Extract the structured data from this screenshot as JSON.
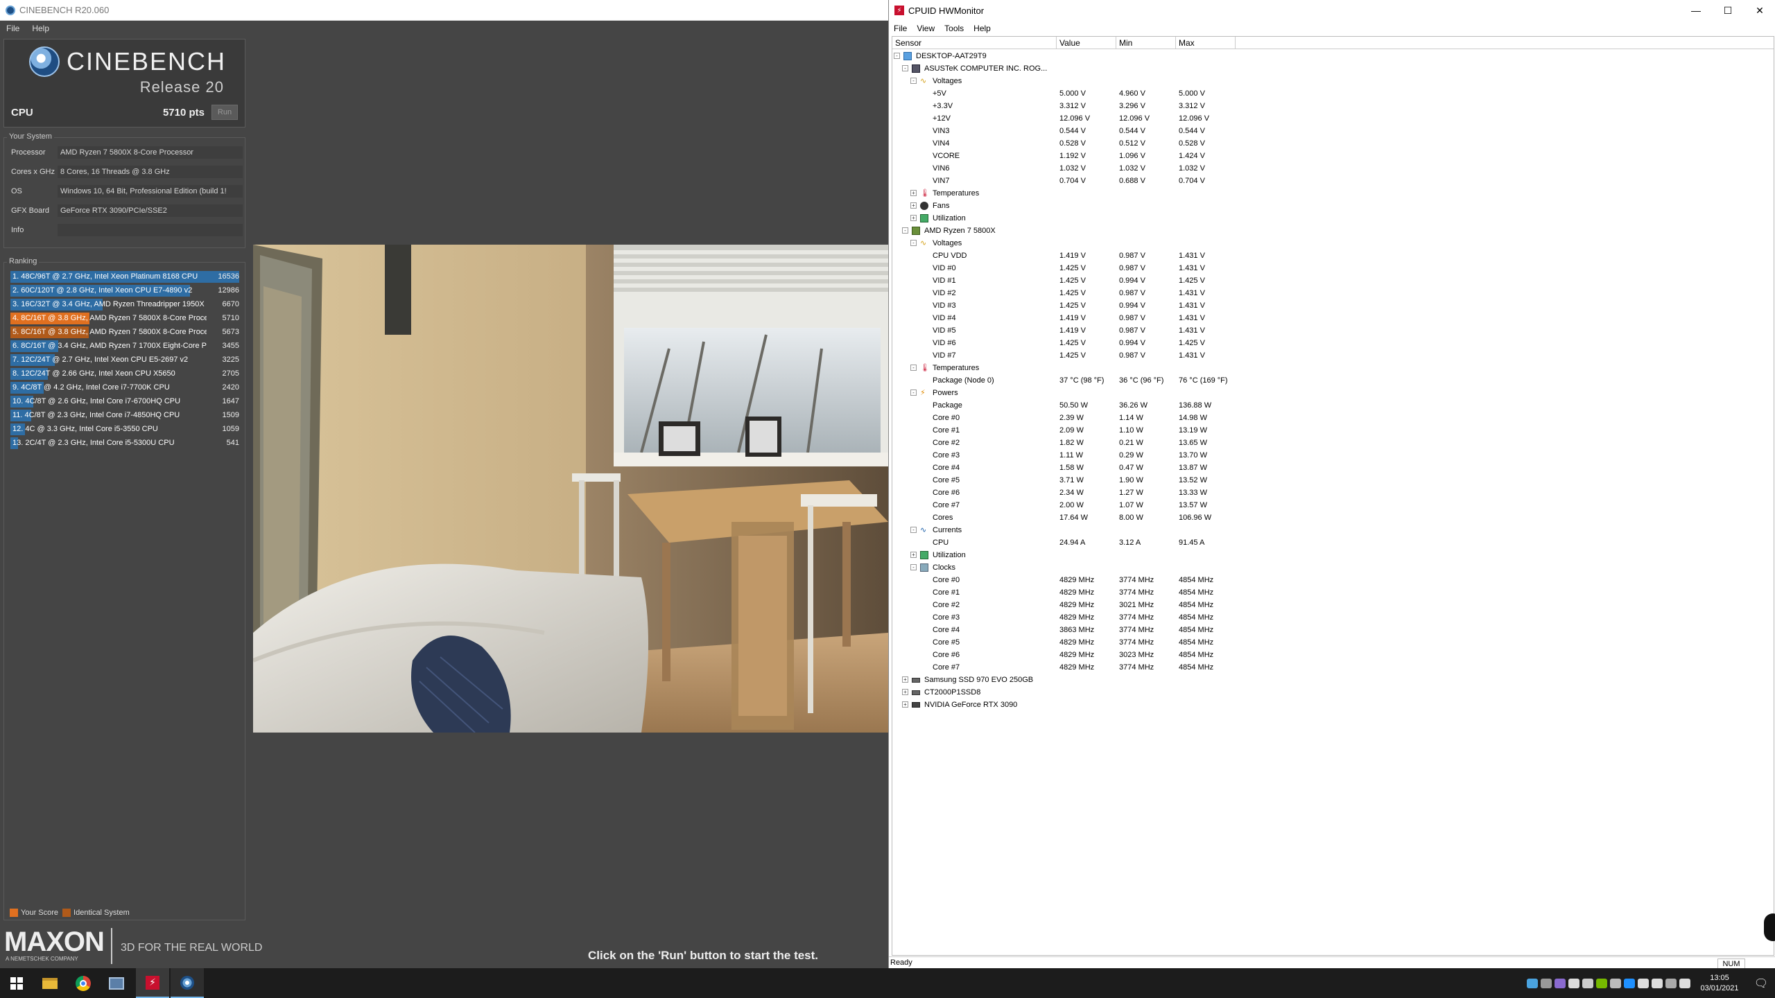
{
  "cinebench": {
    "window_title": "CINEBENCH R20.060",
    "menu": [
      "File",
      "Help"
    ],
    "logo_text": "CINEBENCH",
    "release": "Release 20",
    "cpu_label": "CPU",
    "cpu_score": "5710 pts",
    "run_label": "Run",
    "your_system": {
      "title": "Your System",
      "rows": [
        {
          "label": "Processor",
          "value": "AMD Ryzen 7 5800X 8-Core Processor"
        },
        {
          "label": "Cores x GHz",
          "value": "8 Cores, 16 Threads @ 3.8 GHz"
        },
        {
          "label": "OS",
          "value": "Windows 10, 64 Bit, Professional Edition (build 1!"
        },
        {
          "label": "GFX Board",
          "value": "GeForce RTX 3090/PCIe/SSE2"
        },
        {
          "label": "Info",
          "value": ""
        }
      ]
    },
    "ranking": {
      "title": "Ranking",
      "max_score": 16536,
      "rows": [
        {
          "label": "1. 48C/96T @ 2.7 GHz, Intel Xeon Platinum 8168 CPU",
          "score": "16536",
          "value": 16536,
          "kind": "blue"
        },
        {
          "label": "2. 60C/120T @ 2.8 GHz, Intel Xeon CPU E7-4890 v2",
          "score": "12986",
          "value": 12986,
          "kind": "blue"
        },
        {
          "label": "3. 16C/32T @ 3.4 GHz, AMD Ryzen Threadripper 1950X",
          "score": "6670",
          "value": 6670,
          "kind": "blue"
        },
        {
          "label": "4. 8C/16T @ 3.8 GHz, AMD Ryzen 7 5800X 8-Core Proce:",
          "score": "5710",
          "value": 5710,
          "kind": "your"
        },
        {
          "label": "5. 8C/16T @ 3.8 GHz, AMD Ryzen 7 5800X 8-Core Proce:",
          "score": "5673",
          "value": 5673,
          "kind": "identical"
        },
        {
          "label": "6. 8C/16T @ 3.4 GHz, AMD Ryzen 7 1700X Eight-Core Pi",
          "score": "3455",
          "value": 3455,
          "kind": "blue"
        },
        {
          "label": "7. 12C/24T @ 2.7 GHz, Intel Xeon CPU E5-2697 v2",
          "score": "3225",
          "value": 3225,
          "kind": "blue"
        },
        {
          "label": "8. 12C/24T @ 2.66 GHz, Intel Xeon CPU X5650",
          "score": "2705",
          "value": 2705,
          "kind": "blue"
        },
        {
          "label": "9. 4C/8T @ 4.2 GHz, Intel Core i7-7700K CPU",
          "score": "2420",
          "value": 2420,
          "kind": "blue"
        },
        {
          "label": "10. 4C/8T @ 2.6 GHz, Intel Core i7-6700HQ CPU",
          "score": "1647",
          "value": 1647,
          "kind": "blue"
        },
        {
          "label": "11. 4C/8T @ 2.3 GHz, Intel Core i7-4850HQ CPU",
          "score": "1509",
          "value": 1509,
          "kind": "blue"
        },
        {
          "label": "12. 4C @ 3.3 GHz, Intel Core i5-3550 CPU",
          "score": "1059",
          "value": 1059,
          "kind": "blue"
        },
        {
          "label": "13. 2C/4T @ 2.3 GHz, Intel Core i5-5300U CPU",
          "score": "541",
          "value": 541,
          "kind": "blue"
        }
      ]
    },
    "legend": {
      "your_score": "Your Score",
      "identical_system": "Identical System"
    },
    "footer": {
      "brand": "MAXON",
      "brand_sub": "A NEMETSCHEK COMPANY",
      "tagline": "3D FOR THE REAL WORLD",
      "message": "Click on the 'Run' button to start the test."
    },
    "colors": {
      "blue_bar": "#2e6da4",
      "your_score": "#e07020",
      "identical": "#b05a1a"
    }
  },
  "hwmonitor": {
    "window_title": "CPUID HWMonitor",
    "menu": [
      "File",
      "View",
      "Tools",
      "Help"
    ],
    "columns": [
      "Sensor",
      "Value",
      "Min",
      "Max"
    ],
    "rows": [
      {
        "level": 0,
        "exp": "-",
        "icon": "pc",
        "name": "DESKTOP-AAT29T9"
      },
      {
        "level": 1,
        "exp": "-",
        "icon": "mb",
        "name": "ASUSTeK COMPUTER INC. ROG..."
      },
      {
        "level": 2,
        "exp": "-",
        "icon": "volt",
        "name": "Voltages"
      },
      {
        "level": 3,
        "name": "+5V",
        "value": "5.000 V",
        "min": "4.960 V",
        "max": "5.000 V"
      },
      {
        "level": 3,
        "name": "+3.3V",
        "value": "3.312 V",
        "min": "3.296 V",
        "max": "3.312 V"
      },
      {
        "level": 3,
        "name": "+12V",
        "value": "12.096 V",
        "min": "12.096 V",
        "max": "12.096 V"
      },
      {
        "level": 3,
        "name": "VIN3",
        "value": "0.544 V",
        "min": "0.544 V",
        "max": "0.544 V"
      },
      {
        "level": 3,
        "name": "VIN4",
        "value": "0.528 V",
        "min": "0.512 V",
        "max": "0.528 V"
      },
      {
        "level": 3,
        "name": "VCORE",
        "value": "1.192 V",
        "min": "1.096 V",
        "max": "1.424 V"
      },
      {
        "level": 3,
        "name": "VIN6",
        "value": "1.032 V",
        "min": "1.032 V",
        "max": "1.032 V"
      },
      {
        "level": 3,
        "name": "VIN7",
        "value": "0.704 V",
        "min": "0.688 V",
        "max": "0.704 V"
      },
      {
        "level": 2,
        "exp": "+",
        "icon": "temp",
        "name": "Temperatures"
      },
      {
        "level": 2,
        "exp": "+",
        "icon": "fan",
        "name": "Fans"
      },
      {
        "level": 2,
        "exp": "+",
        "icon": "util",
        "name": "Utilization"
      },
      {
        "level": 1,
        "exp": "-",
        "icon": "cpu",
        "name": "AMD Ryzen 7 5800X"
      },
      {
        "level": 2,
        "exp": "-",
        "icon": "volt",
        "name": "Voltages"
      },
      {
        "level": 3,
        "name": "CPU VDD",
        "value": "1.419 V",
        "min": "0.987 V",
        "max": "1.431 V"
      },
      {
        "level": 3,
        "name": "VID #0",
        "value": "1.425 V",
        "min": "0.987 V",
        "max": "1.431 V"
      },
      {
        "level": 3,
        "name": "VID #1",
        "value": "1.425 V",
        "min": "0.994 V",
        "max": "1.425 V"
      },
      {
        "level": 3,
        "name": "VID #2",
        "value": "1.425 V",
        "min": "0.987 V",
        "max": "1.431 V"
      },
      {
        "level": 3,
        "name": "VID #3",
        "value": "1.425 V",
        "min": "0.994 V",
        "max": "1.431 V"
      },
      {
        "level": 3,
        "name": "VID #4",
        "value": "1.419 V",
        "min": "0.987 V",
        "max": "1.431 V"
      },
      {
        "level": 3,
        "name": "VID #5",
        "value": "1.419 V",
        "min": "0.987 V",
        "max": "1.431 V"
      },
      {
        "level": 3,
        "name": "VID #6",
        "value": "1.425 V",
        "min": "0.994 V",
        "max": "1.425 V"
      },
      {
        "level": 3,
        "name": "VID #7",
        "value": "1.425 V",
        "min": "0.987 V",
        "max": "1.431 V"
      },
      {
        "level": 2,
        "exp": "-",
        "icon": "temp",
        "name": "Temperatures"
      },
      {
        "level": 3,
        "name": "Package (Node 0)",
        "value": "37 °C  (98 °F)",
        "min": "36 °C  (96 °F)",
        "max": "76 °C  (169 °F)"
      },
      {
        "level": 2,
        "exp": "-",
        "icon": "pow",
        "name": "Powers"
      },
      {
        "level": 3,
        "name": "Package",
        "value": "50.50 W",
        "min": "36.26 W",
        "max": "136.88 W"
      },
      {
        "level": 3,
        "name": "Core #0",
        "value": "2.39 W",
        "min": "1.14 W",
        "max": "14.98 W"
      },
      {
        "level": 3,
        "name": "Core #1",
        "value": "2.09 W",
        "min": "1.10 W",
        "max": "13.19 W"
      },
      {
        "level": 3,
        "name": "Core #2",
        "value": "1.82 W",
        "min": "0.21 W",
        "max": "13.65 W"
      },
      {
        "level": 3,
        "name": "Core #3",
        "value": "1.11 W",
        "min": "0.29 W",
        "max": "13.70 W"
      },
      {
        "level": 3,
        "name": "Core #4",
        "value": "1.58 W",
        "min": "0.47 W",
        "max": "13.87 W"
      },
      {
        "level": 3,
        "name": "Core #5",
        "value": "3.71 W",
        "min": "1.90 W",
        "max": "13.52 W"
      },
      {
        "level": 3,
        "name": "Core #6",
        "value": "2.34 W",
        "min": "1.27 W",
        "max": "13.33 W"
      },
      {
        "level": 3,
        "name": "Core #7",
        "value": "2.00 W",
        "min": "1.07 W",
        "max": "13.57 W"
      },
      {
        "level": 3,
        "name": "Cores",
        "value": "17.64 W",
        "min": "8.00 W",
        "max": "106.96 W"
      },
      {
        "level": 2,
        "exp": "-",
        "icon": "cur",
        "name": "Currents"
      },
      {
        "level": 3,
        "name": "CPU",
        "value": "24.94 A",
        "min": "3.12 A",
        "max": "91.45 A"
      },
      {
        "level": 2,
        "exp": "+",
        "icon": "util",
        "name": "Utilization"
      },
      {
        "level": 2,
        "exp": "-",
        "icon": "clk",
        "name": "Clocks"
      },
      {
        "level": 3,
        "name": "Core #0",
        "value": "4829 MHz",
        "min": "3774 MHz",
        "max": "4854 MHz"
      },
      {
        "level": 3,
        "name": "Core #1",
        "value": "4829 MHz",
        "min": "3774 MHz",
        "max": "4854 MHz"
      },
      {
        "level": 3,
        "name": "Core #2",
        "value": "4829 MHz",
        "min": "3021 MHz",
        "max": "4854 MHz"
      },
      {
        "level": 3,
        "name": "Core #3",
        "value": "4829 MHz",
        "min": "3774 MHz",
        "max": "4854 MHz"
      },
      {
        "level": 3,
        "name": "Core #4",
        "value": "3863 MHz",
        "min": "3774 MHz",
        "max": "4854 MHz"
      },
      {
        "level": 3,
        "name": "Core #5",
        "value": "4829 MHz",
        "min": "3774 MHz",
        "max": "4854 MHz"
      },
      {
        "level": 3,
        "name": "Core #6",
        "value": "4829 MHz",
        "min": "3023 MHz",
        "max": "4854 MHz"
      },
      {
        "level": 3,
        "name": "Core #7",
        "value": "4829 MHz",
        "min": "3774 MHz",
        "max": "4854 MHz"
      },
      {
        "level": 1,
        "exp": "+",
        "icon": "disk",
        "name": "Samsung SSD 970 EVO 250GB"
      },
      {
        "level": 1,
        "exp": "+",
        "icon": "disk",
        "name": "CT2000P1SSD8"
      },
      {
        "level": 1,
        "exp": "+",
        "icon": "gpu",
        "name": "NVIDIA GeForce RTX 3090"
      }
    ],
    "status": "Ready",
    "num_indicator": "NUM"
  },
  "taskbar": {
    "time": "13:05",
    "date": "03/01/2021",
    "apps": [
      "start-icon",
      "file-explorer-icon",
      "chrome-icon",
      "app-window-icon",
      "hwmonitor-icon",
      "cinebench-icon"
    ]
  }
}
